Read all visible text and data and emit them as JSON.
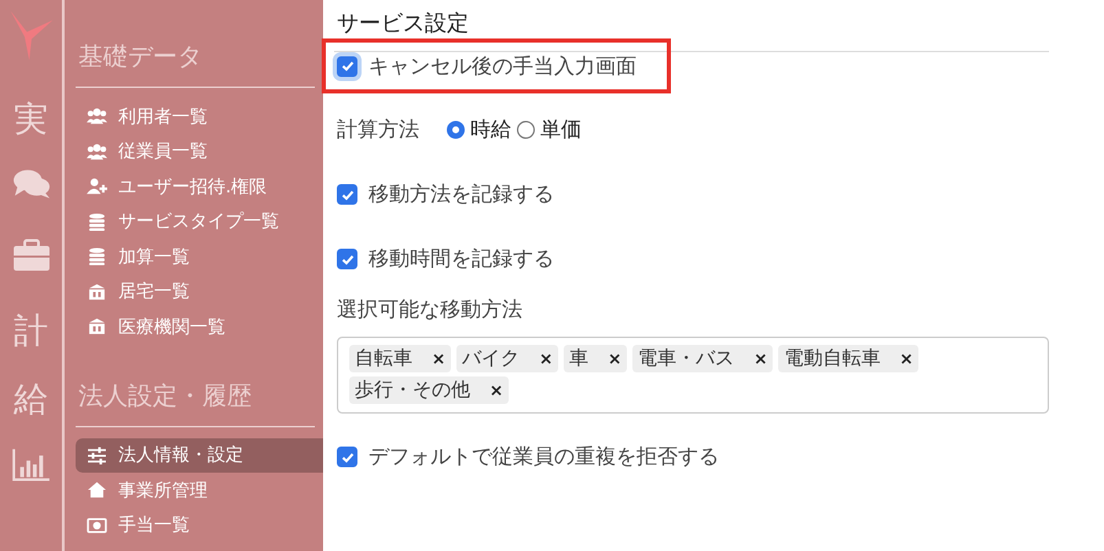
{
  "rail": [
    {
      "kind": "logo"
    },
    {
      "kind": "text",
      "label": "実"
    },
    {
      "kind": "chat"
    },
    {
      "kind": "briefcase"
    },
    {
      "kind": "text",
      "label": "計"
    },
    {
      "kind": "text",
      "label": "給"
    },
    {
      "kind": "chart"
    }
  ],
  "sidebar": {
    "sections": [
      {
        "title": "基礎データ",
        "items": [
          {
            "label": "利用者一覧",
            "kind": "users",
            "selected": false
          },
          {
            "label": "従業員一覧",
            "kind": "users",
            "selected": false
          },
          {
            "label": "ユーザー招待.権限",
            "kind": "user-plus",
            "selected": false
          },
          {
            "label": "サービスタイプ一覧",
            "kind": "database",
            "selected": false
          },
          {
            "label": "加算一覧",
            "kind": "database",
            "selected": false
          },
          {
            "label": "居宅一覧",
            "kind": "building",
            "selected": false
          },
          {
            "label": "医療機関一覧",
            "kind": "building",
            "selected": false
          }
        ]
      },
      {
        "title": "法人設定・履歴",
        "items": [
          {
            "label": "法人情報・設定",
            "kind": "sliders",
            "selected": true
          },
          {
            "label": "事業所管理",
            "kind": "home",
            "selected": false
          },
          {
            "label": "手当一覧",
            "kind": "money",
            "selected": false
          }
        ]
      }
    ]
  },
  "main": {
    "title": "サービス設定",
    "rows": [
      {
        "kind": "checkbox",
        "label": "キャンセル後の手当入力画面",
        "checked": true,
        "highlighted": true
      },
      {
        "kind": "radio",
        "label": "計算方法",
        "options": [
          {
            "label": "時給",
            "selected": true
          },
          {
            "label": "単価",
            "selected": false
          }
        ]
      },
      {
        "kind": "checkbox",
        "label": "移動方法を記録する",
        "checked": true,
        "highlighted": false
      },
      {
        "kind": "checkbox",
        "label": "移動時間を記録する",
        "checked": true,
        "highlighted": false
      },
      {
        "kind": "tags",
        "label": "選択可能な移動方法",
        "tags": [
          {
            "label": "自転車",
            "remove": "×"
          },
          {
            "label": "バイク",
            "remove": "×"
          },
          {
            "label": "車",
            "remove": "×"
          },
          {
            "label": "電車・バス",
            "remove": "×"
          },
          {
            "label": "電動自転車",
            "remove": "×"
          },
          {
            "label": "歩行・その他",
            "remove": "×"
          }
        ]
      },
      {
        "kind": "checkbox",
        "label": "デフォルトで従業員の重複を拒否する",
        "checked": true,
        "highlighted": false
      }
    ]
  }
}
